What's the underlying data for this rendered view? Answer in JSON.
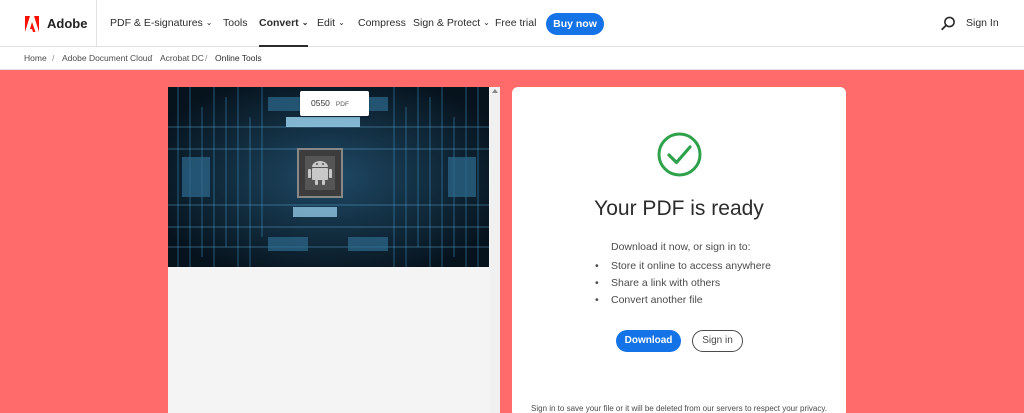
{
  "brand": {
    "name": "Adobe",
    "icon": "adobe-logo"
  },
  "nav": {
    "pdf_esign": "PDF & E-signatures",
    "tools": "Tools",
    "convert": "Convert",
    "edit": "Edit",
    "compress": "Compress",
    "sign_protect": "Sign & Protect",
    "free_trial": "Free trial",
    "buy_now": "Buy now",
    "sign_in": "Sign In",
    "search_icon": "search-icon",
    "chevron_icon": "chevron-down-icon"
  },
  "breadcrumb": {
    "items": [
      "Home",
      "Adobe Document Cloud",
      "Acrobat DC",
      "Online Tools"
    ],
    "separator": "/"
  },
  "preview": {
    "file_name": "0550",
    "file_type": "PDF"
  },
  "result": {
    "title": "Your PDF is ready",
    "intro": "Download it now, or sign in to:",
    "bullets": [
      "Store it online to access anywhere",
      "Share a link with others",
      "Convert another file"
    ],
    "download_label": "Download",
    "signin_label": "Sign in",
    "notice": "Sign in to save your file or it will be deleted from our servers to respect your privacy.",
    "check_icon": "check-circle-icon"
  },
  "colors": {
    "accent": "#1473e6",
    "background": "#ff6b6b",
    "brand_red": "#fa0f00",
    "success": "#2da24a"
  }
}
